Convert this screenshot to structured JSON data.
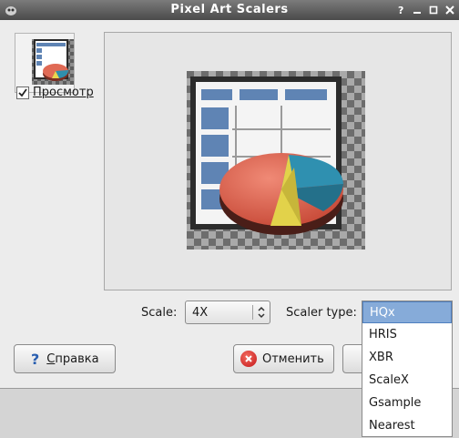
{
  "window": {
    "title": "Pixel Art Scalers"
  },
  "preview": {
    "checkbox_label": "Просмотр",
    "checked": true
  },
  "controls": {
    "scale_label": "Scale:",
    "scale_value": "4X",
    "scaler_type_label": "Scaler type:"
  },
  "dropdown": {
    "options": [
      "HQx",
      "HRIS",
      "XBR",
      "ScaleX",
      "Gsample",
      "Nearest"
    ],
    "selected": "HQx"
  },
  "buttons": {
    "help": "Справка",
    "cancel": "Отменить"
  },
  "colors": {
    "selection": "#86abd9",
    "titlebar": "#5a5a5a"
  }
}
